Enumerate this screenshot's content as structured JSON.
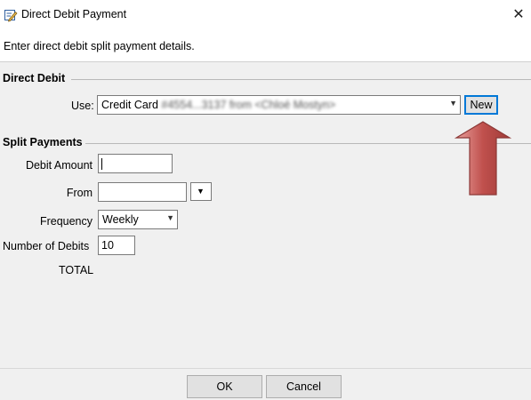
{
  "window": {
    "title": "Direct Debit Payment",
    "close_glyph": "✕"
  },
  "instructions": "Enter direct debit split payment details.",
  "direct_debit": {
    "section_title": "Direct Debit",
    "use_label": "Use:",
    "use_value": "Credit Card #4554...3137 from <Chloé Mostyn>",
    "new_button": "New"
  },
  "split_payments": {
    "section_title": "Split Payments",
    "debit_amount_label": "Debit Amount",
    "debit_amount_value": "",
    "from_label": "From",
    "from_value": "",
    "frequency_label": "Frequency",
    "frequency_value": "Weekly",
    "number_of_debits_label": "Number of Debits",
    "number_of_debits_value": "10",
    "total_label": "TOTAL"
  },
  "footer": {
    "ok_button": "OK",
    "cancel_button": "Cancel"
  },
  "colors": {
    "arrow_fill": "#c0504d",
    "arrow_stroke": "#8c3836",
    "focus_border": "#0078d7"
  },
  "icons": {
    "app": "edit-pencil-icon",
    "close": "close-icon",
    "dropdown": "chevron-down-icon",
    "annotation": "up-arrow-annotation"
  }
}
